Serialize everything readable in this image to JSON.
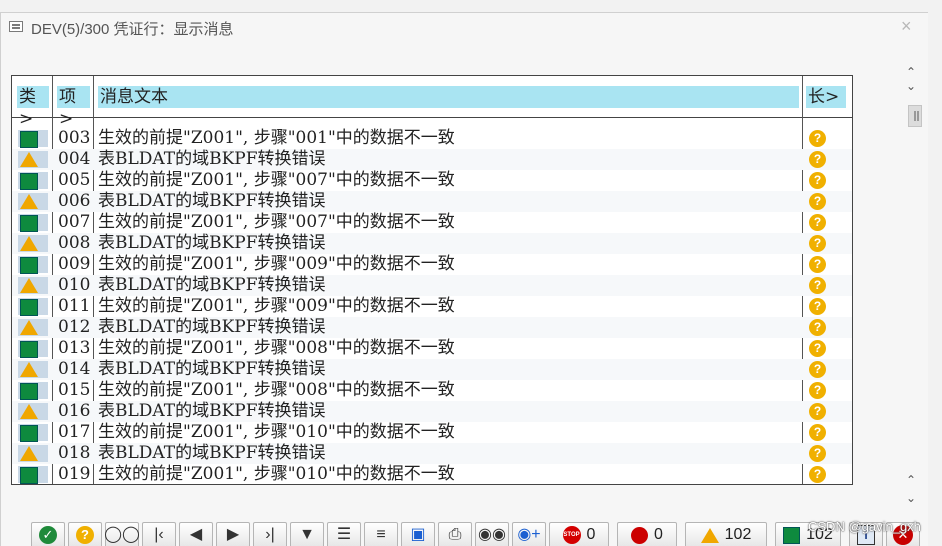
{
  "window": {
    "title": "DEV(5)/300 凭证行：显示消息",
    "close_glyph": "×"
  },
  "columns": {
    "type": "类",
    "item": "项",
    "message": "消息文本",
    "long": "长"
  },
  "rows": [
    {
      "type": "ok",
      "item": "003",
      "text": "生效的前提\"Z001\", 步骤\"001\"中的数据不一致"
    },
    {
      "type": "warn",
      "item": "004",
      "text": "表BLDAT的域BKPF转换错误"
    },
    {
      "type": "ok",
      "item": "005",
      "text": "生效的前提\"Z001\", 步骤\"007\"中的数据不一致"
    },
    {
      "type": "warn",
      "item": "006",
      "text": "表BLDAT的域BKPF转换错误"
    },
    {
      "type": "ok",
      "item": "007",
      "text": "生效的前提\"Z001\", 步骤\"007\"中的数据不一致"
    },
    {
      "type": "warn",
      "item": "008",
      "text": "表BLDAT的域BKPF转换错误"
    },
    {
      "type": "ok",
      "item": "009",
      "text": "生效的前提\"Z001\", 步骤\"009\"中的数据不一致"
    },
    {
      "type": "warn",
      "item": "010",
      "text": "表BLDAT的域BKPF转换错误"
    },
    {
      "type": "ok",
      "item": "011",
      "text": "生效的前提\"Z001\", 步骤\"009\"中的数据不一致"
    },
    {
      "type": "warn",
      "item": "012",
      "text": "表BLDAT的域BKPF转换错误"
    },
    {
      "type": "ok",
      "item": "013",
      "text": "生效的前提\"Z001\", 步骤\"008\"中的数据不一致"
    },
    {
      "type": "warn",
      "item": "014",
      "text": "表BLDAT的域BKPF转换错误"
    },
    {
      "type": "ok",
      "item": "015",
      "text": "生效的前提\"Z001\", 步骤\"008\"中的数据不一致"
    },
    {
      "type": "warn",
      "item": "016",
      "text": "表BLDAT的域BKPF转换错误"
    },
    {
      "type": "ok",
      "item": "017",
      "text": "生效的前提\"Z001\", 步骤\"010\"中的数据不一致"
    },
    {
      "type": "warn",
      "item": "018",
      "text": "表BLDAT的域BKPF转换错误"
    },
    {
      "type": "ok",
      "item": "019",
      "text": "生效的前提\"Z001\", 步骤\"010\"中的数据不一致"
    }
  ],
  "help_glyph": "?",
  "toolbar": {
    "stop_label": "STOP",
    "stop_count": "0",
    "error_count": "0",
    "warning_count": "102",
    "success_count": "102"
  },
  "watermark": "CSDN @gavin_gxh",
  "colors": {
    "header_bg": "#a9e4f2",
    "success": "#0e8a3e",
    "warning": "#f0a700",
    "error": "#cc0000",
    "help": "#f0b000"
  }
}
